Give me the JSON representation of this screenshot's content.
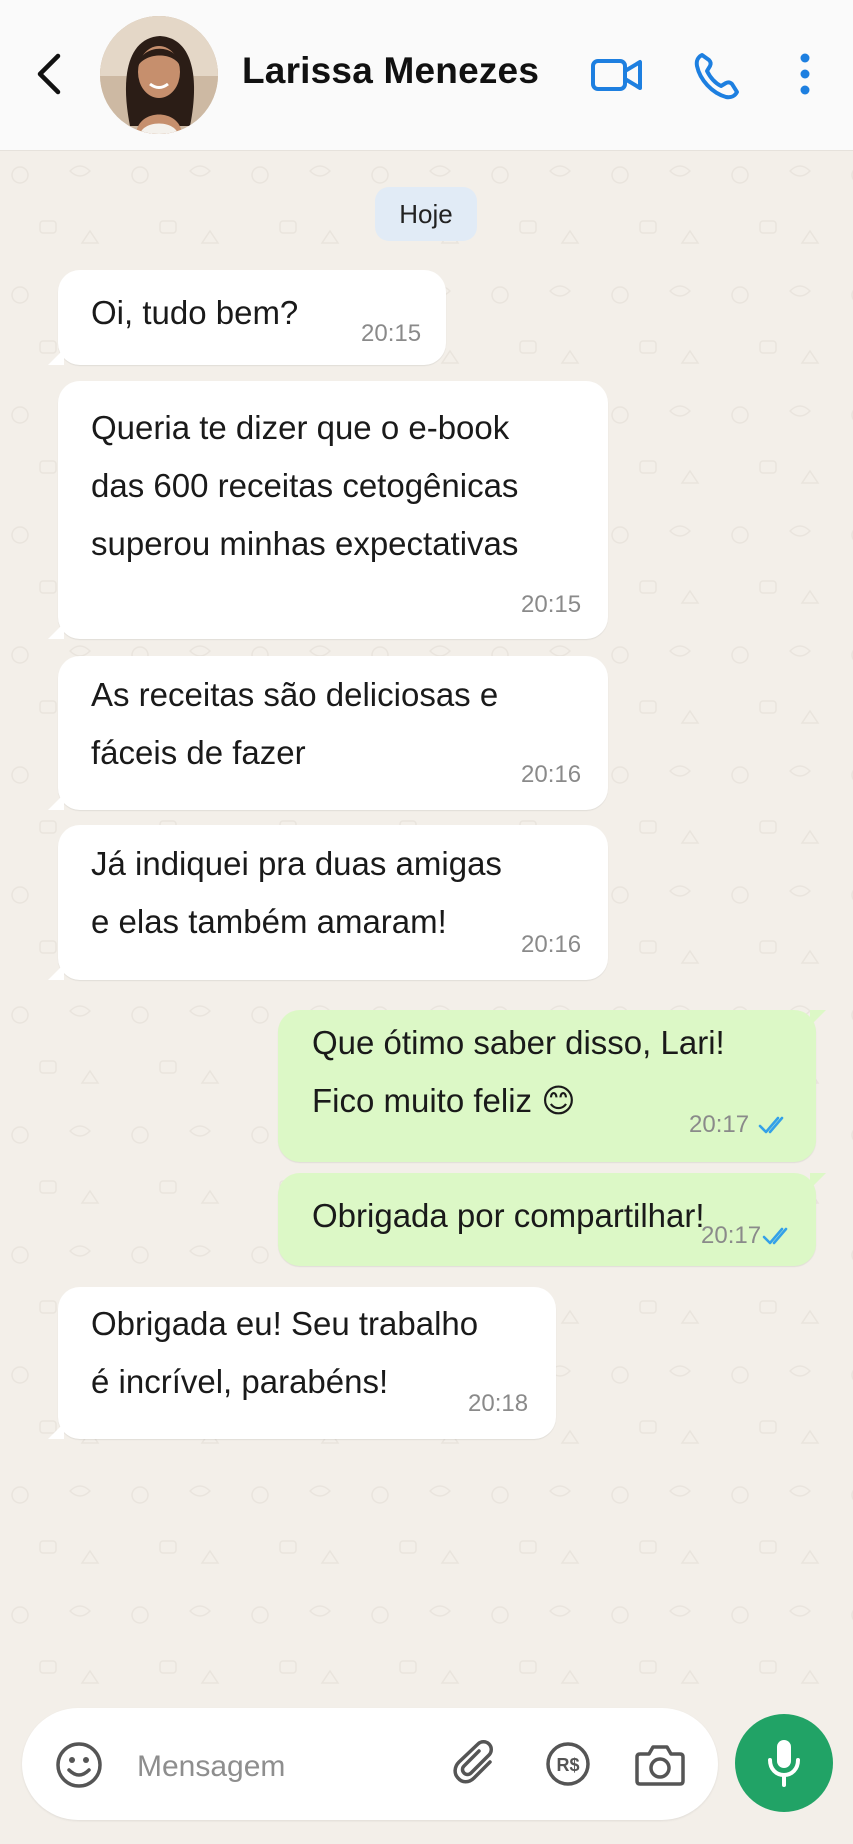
{
  "header": {
    "contact_name": "Larissa Menezes",
    "back_icon": "chevron-left-icon",
    "video_icon": "video-camera-icon",
    "call_icon": "phone-icon",
    "menu_icon": "more-vertical-icon",
    "accent_color": "#1d7fe0"
  },
  "chat": {
    "date_label": "Hoje",
    "messages": [
      {
        "direction": "in",
        "text": "Oi, tudo bem?",
        "time": "20:15"
      },
      {
        "direction": "in",
        "text": "Queria te dizer que o e-book\ndas 600 receitas cetogênicas\nsuperou minhas expectativas",
        "time": "20:15"
      },
      {
        "direction": "in",
        "text": "As receitas são deliciosas e\nfáceis de fazer",
        "time": "20:16"
      },
      {
        "direction": "in",
        "text": "Já indiquei pra duas amigas\ne elas também amaram!",
        "time": "20:16"
      },
      {
        "direction": "out",
        "text": "Que ótimo saber disso, Lari!\nFico muito feliz 😊",
        "time": "20:17",
        "status": "read"
      },
      {
        "direction": "out",
        "text": "Obrigada por compartilhar!",
        "time": "20:17",
        "status": "read"
      },
      {
        "direction": "in",
        "text": "Obrigada eu! Seu trabalho\né incrível, parabéns!",
        "time": "20:18"
      }
    ],
    "incoming_bubble_color": "#ffffff",
    "outgoing_bubble_color": "#dcf8c6",
    "read_tick_color": "#34a1e8"
  },
  "composer": {
    "placeholder": "Mensagem",
    "emoji_icon": "emoji-icon",
    "attach_icon": "paperclip-icon",
    "payment_icon": "real-currency-icon",
    "payment_label": "R$",
    "camera_icon": "camera-icon",
    "mic_icon": "microphone-icon",
    "mic_color": "#21a366"
  }
}
